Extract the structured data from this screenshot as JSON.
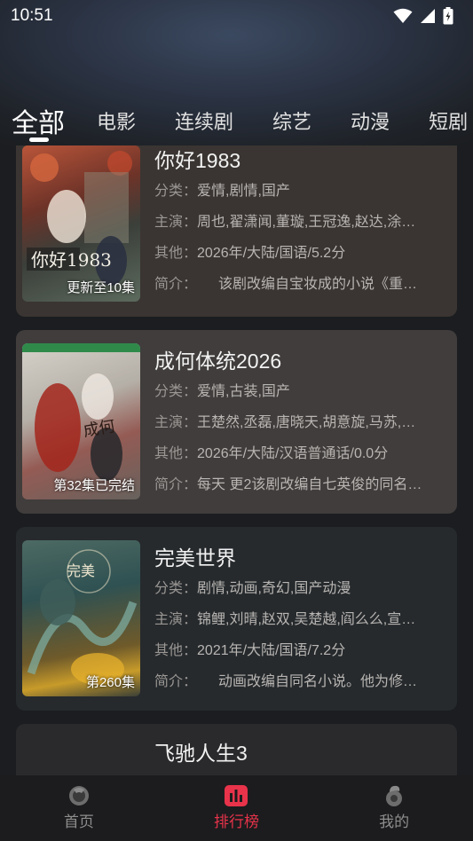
{
  "status_bar": {
    "time": "10:51"
  },
  "tabs": [
    "全部",
    "电影",
    "连续剧",
    "综艺",
    "动漫",
    "短剧"
  ],
  "labels": {
    "category": "分类：",
    "cast": "主演：",
    "other": "其他：",
    "intro": "简介："
  },
  "items": [
    {
      "title": "你好1983",
      "badge": "更新至10集",
      "category": "爱情,剧情,国产",
      "cast": "周也,翟潇闻,董璇,王冠逸,赵达,涂…",
      "other": "2026年/大陆/国语/5.2分",
      "intro": "　　该剧改编自宝妆成的小说《重…"
    },
    {
      "title": "成何体统2026",
      "badge": "第32集已完结",
      "category": "爱情,古装,国产",
      "cast": "王楚然,丞磊,唐晓天,胡意旋,马苏,…",
      "other": "2026年/大陆/汉语普通话/0.0分",
      "intro": "每天 更2该剧改编自七英俊的同名…"
    },
    {
      "title": "完美世界",
      "badge": "第260集",
      "category": "剧情,动画,奇幻,国产动漫",
      "cast": "锦鲤,刘晴,赵双,吴楚越,阎么么,宣…",
      "other": "2021年/大陆/国语/7.2分",
      "intro": "　　动画改编自同名小说。他为修…"
    },
    {
      "title": "飞驰人生3"
    }
  ],
  "bottom_nav": [
    {
      "label": "首页",
      "icon": "home-icon"
    },
    {
      "label": "排行榜",
      "icon": "ranking-icon"
    },
    {
      "label": "我的",
      "icon": "profile-icon"
    }
  ],
  "colors": {
    "accent": "#e8334a",
    "background": "#1b1d20"
  }
}
